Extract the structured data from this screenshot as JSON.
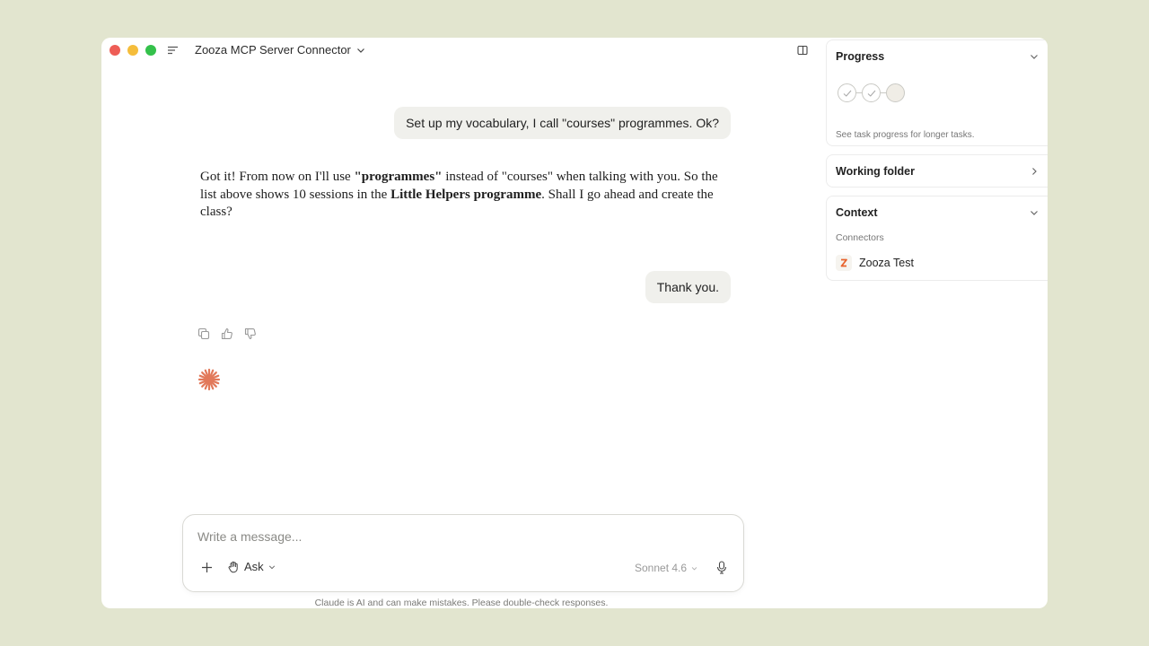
{
  "window": {
    "title": "Zooza MCP Server Connector"
  },
  "conversation": {
    "user_message_1": "Set up my vocabulary, I call \"courses\" programmes. Ok?",
    "assistant_reply": {
      "p1": "Got it! From now on I'll use ",
      "b1": "\"programmes\"",
      "p2": " instead of \"courses\" when talking with you. So the list above shows 10 sessions in the ",
      "b2": "Little Helpers programme",
      "p3": ". Shall I go ahead and create the class?"
    },
    "user_message_2": "Thank you."
  },
  "composer": {
    "placeholder": "Write a message...",
    "mode_label": "Ask",
    "model_label": "Sonnet 4.6",
    "disclaimer": "Claude is AI and can make mistakes. Please double-check responses."
  },
  "panels": {
    "progress": {
      "title": "Progress",
      "steps": [
        "done",
        "done",
        "pending"
      ],
      "hint": "See task progress for longer tasks."
    },
    "working_folder": {
      "title": "Working folder"
    },
    "context": {
      "title": "Context",
      "connectors_label": "Connectors",
      "connector_name": "Zooza Test"
    }
  },
  "colors": {
    "background": "#e2e5cf",
    "accent_spark": "#e2795a",
    "bubble": "#f0f0ec",
    "zooza_logo": "#e8622c"
  },
  "icons": [
    "menu-icon",
    "chevron-down-icon",
    "panel-toggle-icon",
    "copy-icon",
    "thumbs-up-icon",
    "thumbs-down-icon",
    "claude-spark-icon",
    "plus-icon",
    "hand-icon",
    "microphone-icon",
    "check-icon",
    "chevron-right-icon",
    "zooza-logo-icon"
  ]
}
